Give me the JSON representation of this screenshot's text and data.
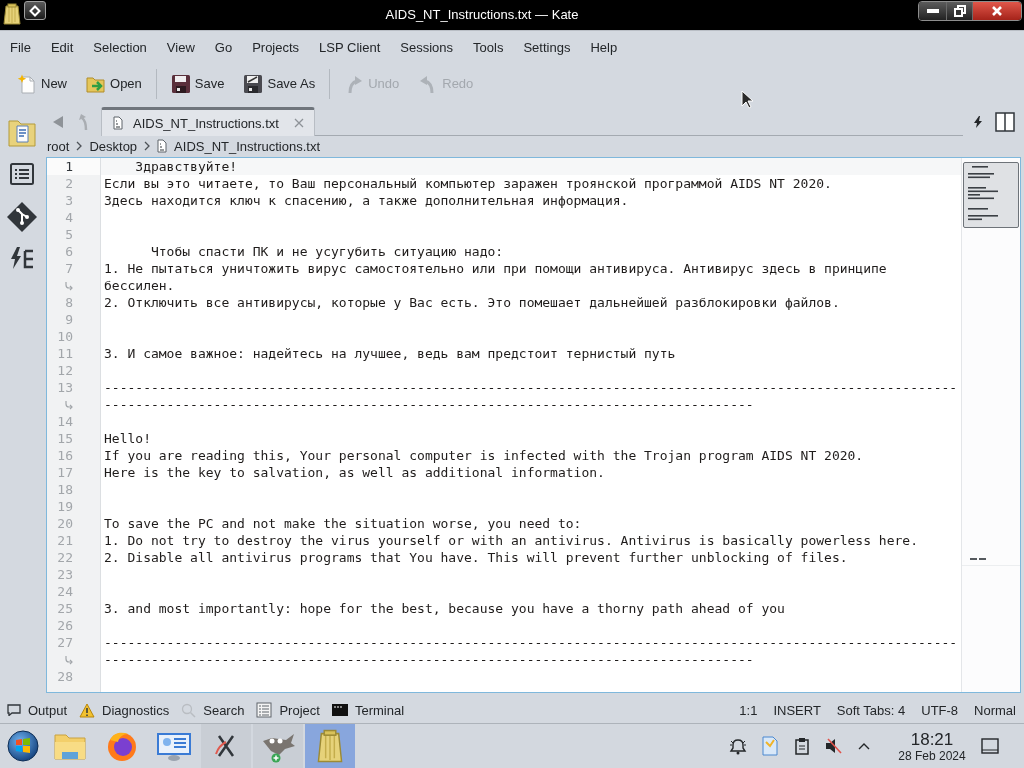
{
  "window": {
    "title": "AIDS_NT_Instructions.txt — Kate"
  },
  "menu": [
    "File",
    "Edit",
    "Selection",
    "View",
    "Go",
    "Projects",
    "LSP Client",
    "Sessions",
    "Tools",
    "Settings",
    "Help"
  ],
  "toolbar": [
    [
      {
        "label": "New",
        "disabled": false
      },
      {
        "label": "Open",
        "disabled": false
      }
    ],
    [
      {
        "label": "Save",
        "disabled": false
      },
      {
        "label": "Save As",
        "disabled": false
      }
    ],
    [
      {
        "label": "Undo",
        "disabled": true
      },
      {
        "label": "Redo",
        "disabled": true
      }
    ]
  ],
  "tabs": [
    {
      "label": "AIDS_NT_Instructions.txt",
      "selected": true
    }
  ],
  "breadcrumb": [
    "root",
    "Desktop",
    "AIDS_NT_Instructions.txt"
  ],
  "editor": {
    "lines": [
      {
        "number": "1",
        "text": "    Здравствуйте!",
        "current": true
      },
      {
        "number": "2",
        "text": "Если вы это читаете, то Ваш персональный компьютер заражен троянской программой AIDS NT 2020.",
        "current": false
      },
      {
        "number": "3",
        "text": "Здесь находится ключ к спасению, а также дополнительная информация.",
        "current": false
      },
      {
        "number": "4",
        "current": false
      },
      {
        "number": "5",
        "current": false
      },
      {
        "number": "6",
        "text": "      Чтобы спасти ПК и не усугубить ситуацию надо:",
        "current": false
      },
      {
        "number": "7",
        "text": "1. Не пытаться уничтожить вирус самостоятельно или при помощи антивируса. Антивирус здесь в принципе бессилен.",
        "current": false
      },
      {
        "number": "8",
        "text": "2. Отключить все антивирусы, которые у Вас есть. Это помешает дальнейшей разблокировки файлов.",
        "current": false
      },
      {
        "number": "9",
        "current": false
      },
      {
        "number": "10",
        "current": false
      },
      {
        "number": "11",
        "text": "3. И самое важное: надейтесь на лучшее, ведь вам предстоит тернистый путь",
        "current": false
      },
      {
        "number": "12",
        "current": false
      },
      {
        "number": "13",
        "text": "------------------------------------------------------------------------------------------------------------------------------------------------------------------------------------------------",
        "current": false
      },
      {
        "number": "14",
        "current": false
      },
      {
        "number": "15",
        "text": "Hello!",
        "current": false
      },
      {
        "number": "16",
        "text": "If you are reading this, Your personal computer is infected with the Trojan program AIDS NT 2020.",
        "current": false
      },
      {
        "number": "17",
        "text": "Here is the key to salvation, as well as additional information.",
        "current": false
      },
      {
        "number": "18",
        "current": false
      },
      {
        "number": "19",
        "current": false
      },
      {
        "number": "20",
        "text": "To save the PC and not make the situation worse, you need to:",
        "current": false
      },
      {
        "number": "21",
        "text": "1. Do not try to destroy the virus yourself or with an antivirus. Antivirus is basically powerless here.",
        "current": false
      },
      {
        "number": "22",
        "text": "2. Disable all antivirus programs that You have. This will prevent further unblocking of files.",
        "current": false
      },
      {
        "number": "23",
        "current": false
      },
      {
        "number": "24",
        "current": false
      },
      {
        "number": "25",
        "text": "3. and most importantly: hope for the best, because you have a thorny path ahead of you",
        "current": false
      },
      {
        "number": "26",
        "current": false
      },
      {
        "number": "27",
        "text": "------------------------------------------------------------------------------------------------------------------------------------------------------------------------------------------------",
        "current": false
      },
      {
        "number": "28",
        "current": false
      }
    ]
  },
  "bottom_panel": {
    "tools": [
      "Output",
      "Diagnostics",
      "Search",
      "Project",
      "Terminal"
    ]
  },
  "status_bar": [
    "1:1",
    "INSERT",
    "Soft Tabs: 4",
    "UTF-8",
    "Normal"
  ],
  "taskbar": {
    "tasks": [
      {
        "selected": false
      },
      {
        "selected": false
      },
      {
        "selected": true
      }
    ],
    "tray": {
      "muted": true
    },
    "clock": {
      "time": "18:21",
      "date": "28 Feb 2024"
    }
  }
}
